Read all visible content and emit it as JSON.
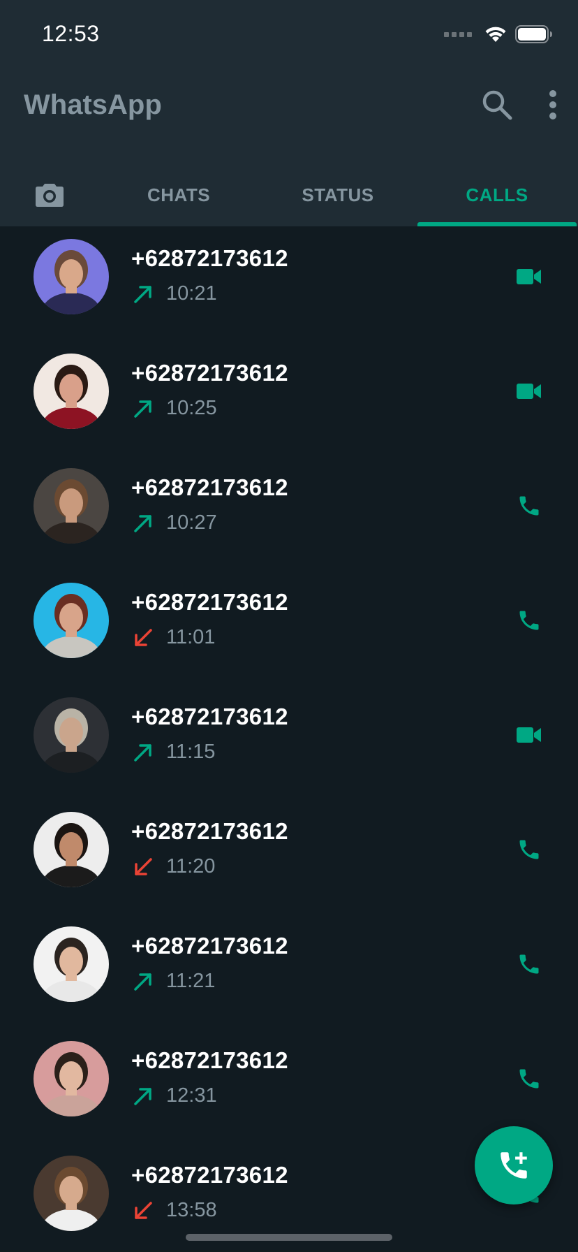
{
  "status_bar": {
    "time": "12:53"
  },
  "app_bar": {
    "title": "WhatsApp",
    "icons": [
      "search-icon",
      "more-vertical-icon"
    ]
  },
  "tabs": [
    {
      "label": "",
      "icon": "camera-icon",
      "active": false
    },
    {
      "label": "CHATS",
      "active": false
    },
    {
      "label": "STATUS",
      "active": false
    },
    {
      "label": "CALLS",
      "active": true
    }
  ],
  "colors": {
    "accent": "#00a884",
    "outgoing": "#00a884",
    "missed": "#ea4335",
    "header": "#1f2c34",
    "background": "#111b21",
    "muted_text": "#8696a0"
  },
  "calls": [
    {
      "name": "+62872173612",
      "time": "10:21",
      "direction": "outgoing",
      "type": "video"
    },
    {
      "name": "+62872173612",
      "time": "10:25",
      "direction": "outgoing",
      "type": "video"
    },
    {
      "name": "+62872173612",
      "time": "10:27",
      "direction": "outgoing",
      "type": "voice"
    },
    {
      "name": "+62872173612",
      "time": "11:01",
      "direction": "missed",
      "type": "voice"
    },
    {
      "name": "+62872173612",
      "time": "11:15",
      "direction": "outgoing",
      "type": "video"
    },
    {
      "name": "+62872173612",
      "time": "11:20",
      "direction": "missed",
      "type": "voice"
    },
    {
      "name": "+62872173612",
      "time": "11:21",
      "direction": "outgoing",
      "type": "voice"
    },
    {
      "name": "+62872173612",
      "time": "12:31",
      "direction": "outgoing",
      "type": "voice"
    },
    {
      "name": "+62872173612",
      "time": "13:58",
      "direction": "missed",
      "type": "voice"
    }
  ],
  "fab": {
    "icon": "add-call-icon"
  }
}
